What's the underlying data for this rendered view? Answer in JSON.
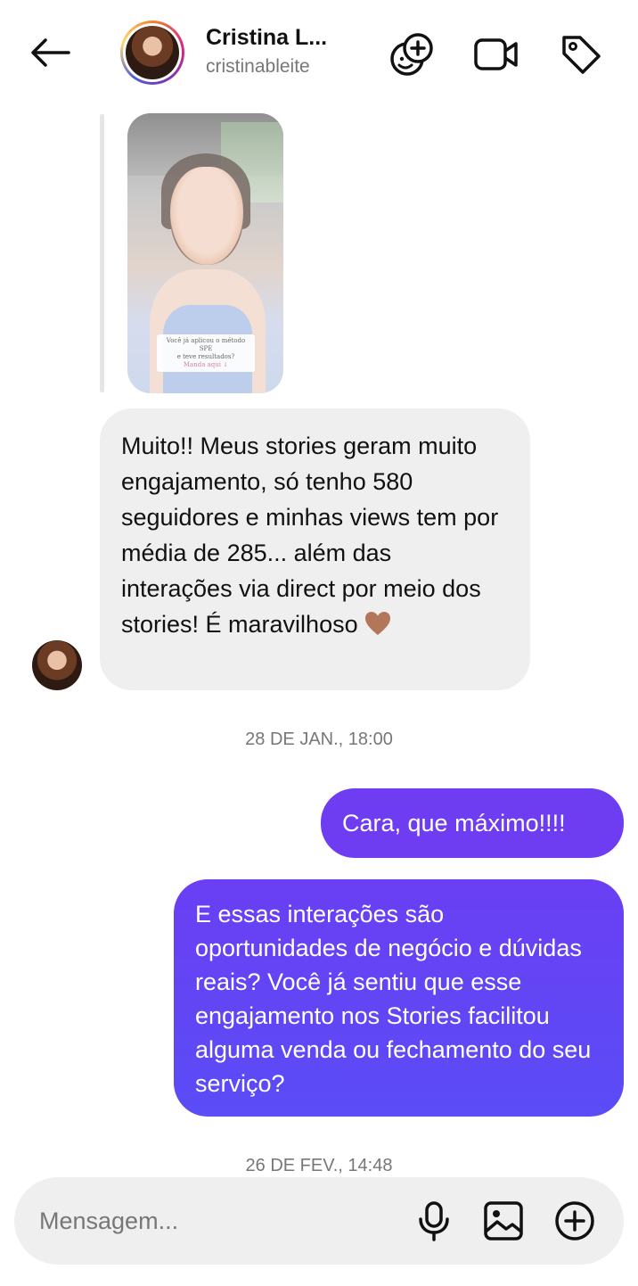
{
  "header": {
    "name": "Cristina L...",
    "username": "cristinableite",
    "icons": [
      "back-arrow-icon",
      "sticker-add-icon",
      "video-call-icon",
      "tag-icon"
    ]
  },
  "story": {
    "caption_line1": "Você já aplicou o método SPE",
    "caption_line2": "e teve resultados?",
    "caption_cta": "Manda aqui ↓"
  },
  "messages": {
    "received_1": "Muito!! Meus stories geram muito engajamento, só tenho 580 seguidores e minhas views tem por média de 285... além das interações via direct por meio dos stories! É maravilhoso",
    "received_1_emoji": "brown-heart",
    "timestamp_1": "28 DE JAN., 18:00",
    "sent_1": "Cara, que máximo!!!!",
    "sent_2": "E essas interações são oportunidades de negócio e dúvidas reais? Você já sentiu que esse engajamento nos Stories facilitou alguma venda ou fechamento do seu serviço?",
    "timestamp_2": "26 DE FEV., 14:48"
  },
  "composer": {
    "placeholder": "Mensagem...",
    "icons": [
      "microphone-icon",
      "gallery-icon",
      "plus-circle-icon"
    ]
  },
  "colors": {
    "sent_bubble": "#6e3df2",
    "received_bubble": "#efefef",
    "muted_text": "#777777",
    "heart": "#b4765b"
  }
}
